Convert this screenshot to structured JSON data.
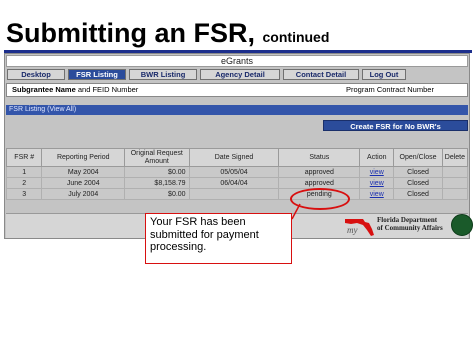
{
  "slide": {
    "title": "Submitting an FSR,",
    "subtitle": "continued"
  },
  "app": {
    "name": "eGrants"
  },
  "tabs": [
    {
      "label": "Desktop",
      "active": false
    },
    {
      "label": "FSR Listing",
      "active": true
    },
    {
      "label": "BWR Listing",
      "active": false
    },
    {
      "label": "Agency Detail",
      "active": false
    },
    {
      "label": "Contact Detail",
      "active": false
    },
    {
      "label": "Log Out",
      "active": false
    }
  ],
  "grantee": {
    "label_bold": "Subgrantee Name",
    "label_rest": " and FEID Number",
    "contract_label": "Program Contract Number"
  },
  "listing": {
    "header": "FSR Listing (View All)",
    "create_button": "Create FSR for No BWR's"
  },
  "table": {
    "headers": [
      "FSR #",
      "Reporting Period",
      "Original Request Amount",
      "Date Signed",
      "Status",
      "Action",
      "Open/Close",
      "Delete"
    ],
    "rows": [
      {
        "num": "1",
        "period": "May 2004",
        "amount": "$0.00",
        "date": "05/05/04",
        "status": "approved",
        "action": "view",
        "open": "Closed",
        "delete": ""
      },
      {
        "num": "2",
        "period": "June 2004",
        "amount": "$8,158.79",
        "date": "06/04/04",
        "status": "approved",
        "action": "view",
        "open": "Closed",
        "delete": ""
      },
      {
        "num": "3",
        "period": "July 2004",
        "amount": "$0.00",
        "date": "",
        "status": "pending",
        "action": "view",
        "open": "Closed",
        "delete": ""
      }
    ]
  },
  "callout": {
    "text": "Your FSR has been submitted for payment processing."
  },
  "logo": {
    "line1": "Florida Department",
    "line2": "of Community Affairs"
  },
  "colors": {
    "accent": "#2b4c9b",
    "annotation": "#d81010",
    "title_rule": "#1d2f8c"
  }
}
